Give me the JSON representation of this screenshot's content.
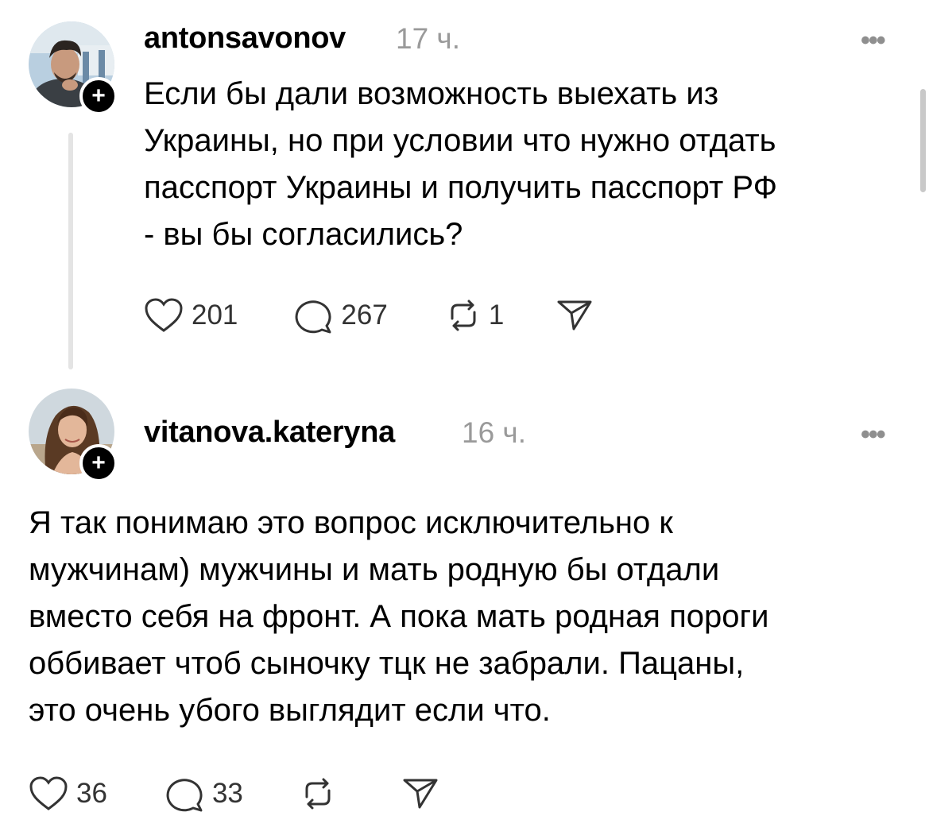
{
  "posts": [
    {
      "username": "antonsavonov",
      "time": "17 ч.",
      "more": "•••",
      "follow": "+",
      "text": "Если бы дали возможность выехать из\nУкраины, но при условии что нужно отдать\nпасспорт Украины и получить пасспорт РФ\n- вы бы согласились?",
      "likes": "201",
      "replies": "267",
      "reposts": "1"
    },
    {
      "username": "vitanova.kateryna",
      "time": "16 ч.",
      "more": "•••",
      "follow": "+",
      "text": "Я так понимаю это вопрос исключительно к\nмужчинам)  мужчины и мать родную бы отдали\nвместо себя на фронт. А пока мать родная пороги\nоббивает чтоб сыночку тцк не забрали. Пацаны,\nэто очень убого выглядит если что.",
      "likes": "36",
      "replies": "33",
      "reposts": ""
    }
  ],
  "icons": {
    "like": "heart-icon",
    "reply": "comment-bubble-icon",
    "repost": "repost-icon",
    "share": "send-icon"
  }
}
